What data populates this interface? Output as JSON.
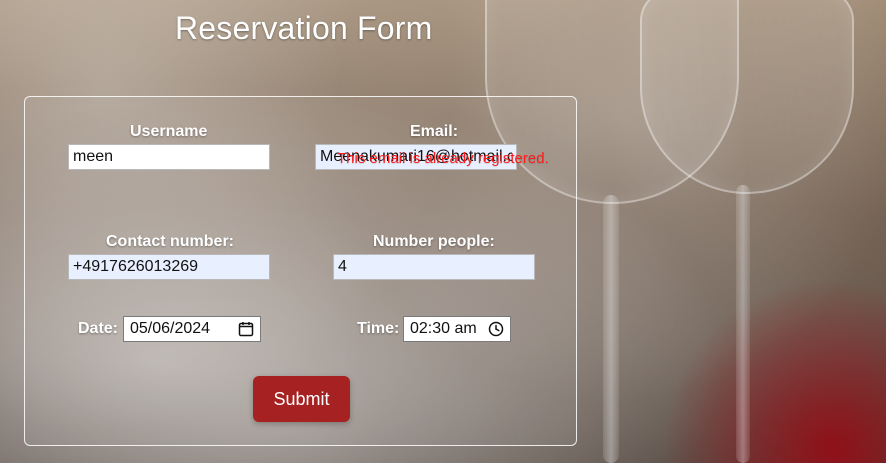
{
  "page": {
    "title": "Reservation Form"
  },
  "form": {
    "username": {
      "label": "Username",
      "value": "meen"
    },
    "email": {
      "label": "Email:",
      "value": "Meenakumari16@hotmail.c",
      "error": "This email is already registered."
    },
    "contact_number": {
      "label": "Contact number:",
      "value": "+4917626013269"
    },
    "number_people": {
      "label": "Number people:",
      "value": "4"
    },
    "date": {
      "label": "Date:",
      "value": "05/06/2024",
      "icon": "calendar-icon"
    },
    "time": {
      "label": "Time:",
      "value": "02:30 am",
      "icon": "clock-icon"
    },
    "submit_label": "Submit"
  },
  "colors": {
    "submit_bg": "#a62121",
    "error_text": "#ff1b1b",
    "panel_border": "#ffffff"
  }
}
